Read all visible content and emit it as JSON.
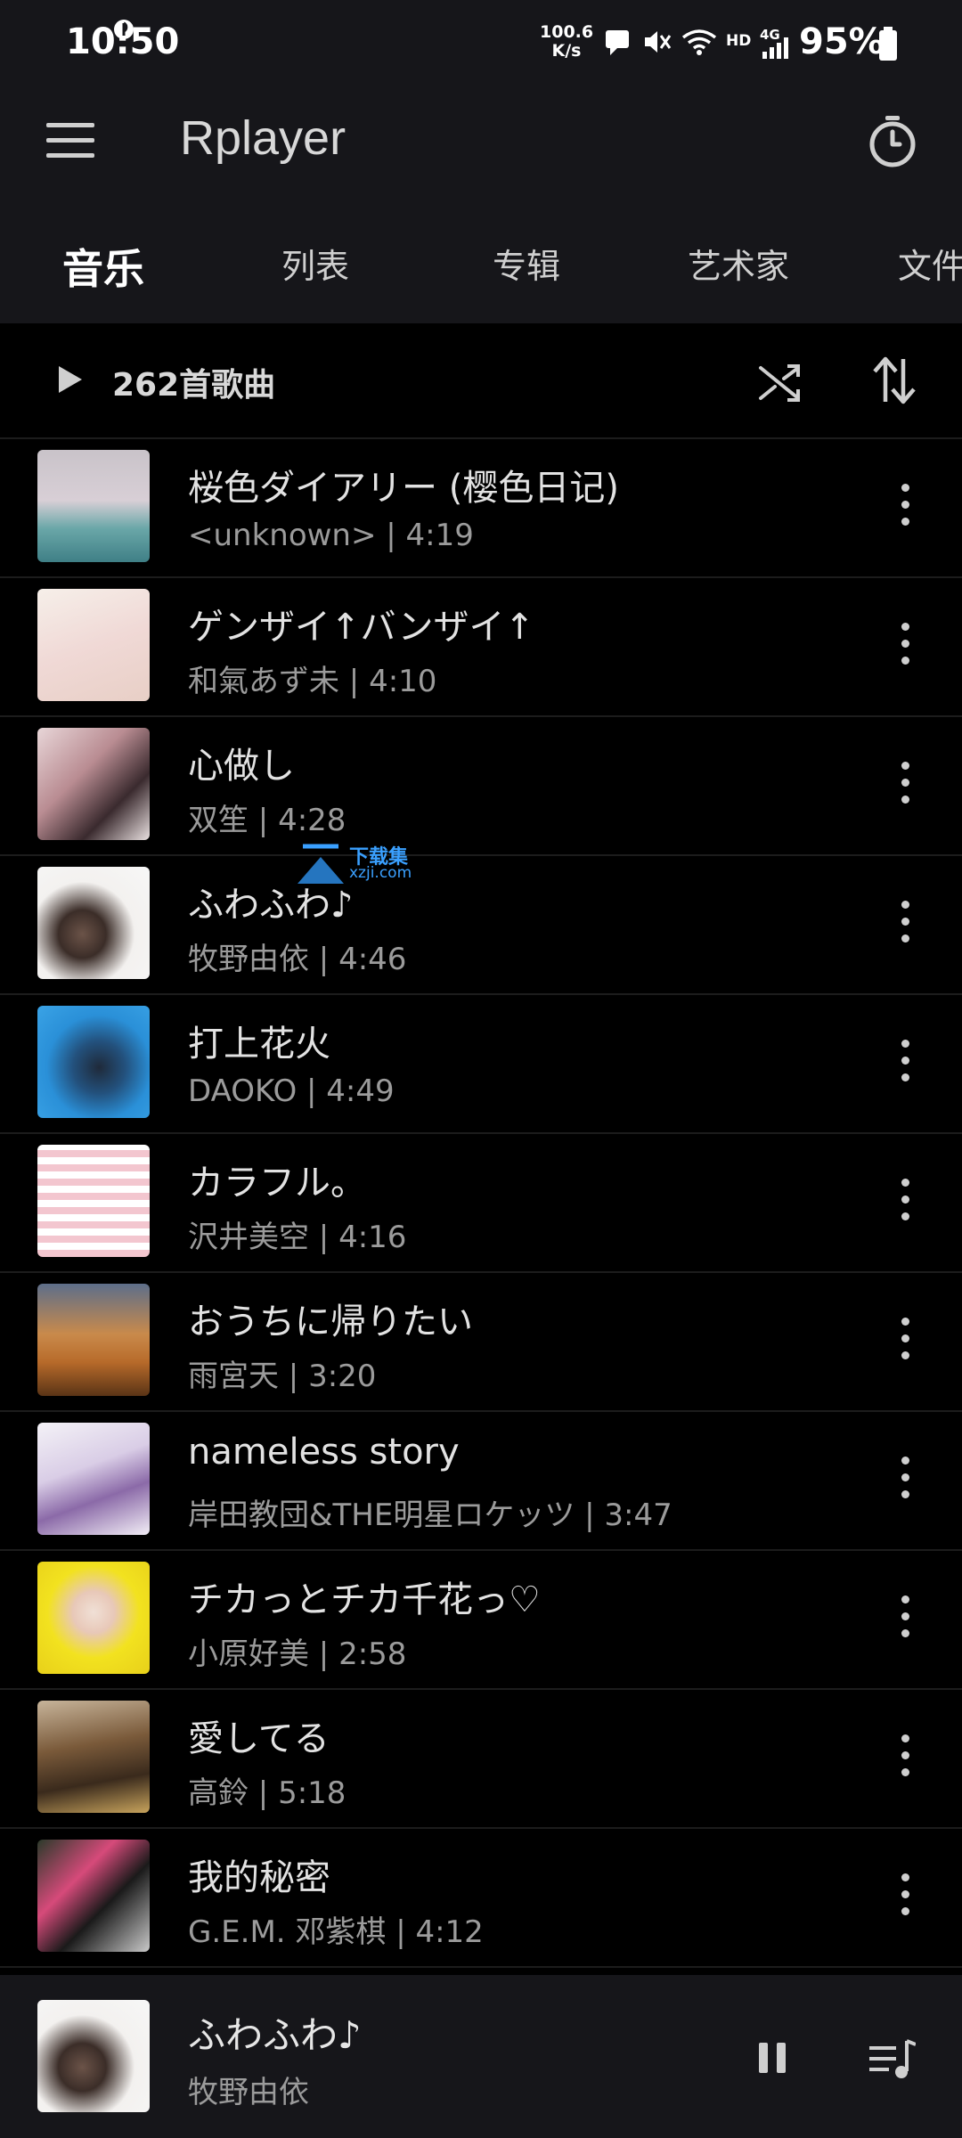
{
  "status_bar": {
    "time": "10:50",
    "net_speed_value": "100.6",
    "net_speed_unit": "K/s",
    "hd": "HD",
    "network": "4G",
    "battery": "95%"
  },
  "toolbar": {
    "title": "Rplayer"
  },
  "tabs": [
    {
      "label": "音乐",
      "active": true
    },
    {
      "label": "列表"
    },
    {
      "label": "专辑"
    },
    {
      "label": "艺术家"
    },
    {
      "label": "文件"
    }
  ],
  "header": {
    "song_count": "262首歌曲"
  },
  "songs": [
    {
      "title": "桜色ダイアリー (樱色日记)",
      "subtitle": "<unknown> | 4:19"
    },
    {
      "title": "ゲンザイ↑バンザイ↑",
      "subtitle": "和氣あず未 | 4:10"
    },
    {
      "title": "心做し",
      "subtitle": "双笙 | 4:28"
    },
    {
      "title": "ふわふわ♪",
      "subtitle": "牧野由依 | 4:46"
    },
    {
      "title": "打上花火",
      "subtitle": "DAOKO | 4:49"
    },
    {
      "title": "カラフル。",
      "subtitle": "沢井美空 | 4:16"
    },
    {
      "title": "おうちに帰りたい",
      "subtitle": "雨宮天 | 3:20"
    },
    {
      "title": "nameless story",
      "subtitle": "岸田教団&THE明星ロケッツ | 3:47"
    },
    {
      "title": "チカっとチカ千花っ♡",
      "subtitle": "小原好美 | 2:58"
    },
    {
      "title": "愛してる",
      "subtitle": "高鈴 | 5:18"
    },
    {
      "title": "我的秘密",
      "subtitle": "G.E.M. 邓紫棋 | 4:12"
    }
  ],
  "now_playing": {
    "title": "ふわふわ♪",
    "artist": "牧野由依"
  },
  "watermark": {
    "name": "下载集",
    "url": "xzji.com"
  },
  "colors": {
    "background": "#000000",
    "bar": "#16161a",
    "accent": "#3aa0ff"
  }
}
